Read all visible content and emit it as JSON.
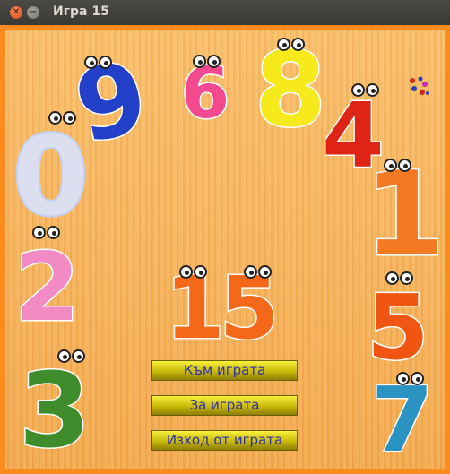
{
  "window": {
    "title": "Игра 15"
  },
  "menu": {
    "start": "Към играта",
    "about": "За играта",
    "exit": "Изход от играта"
  },
  "digits": {
    "nine": "9",
    "six": "6",
    "eight": "8",
    "four": "4",
    "zero": "0",
    "one": "1",
    "two": "2",
    "five": "5",
    "title_fifteen": "15",
    "three": "3",
    "seven": "7"
  },
  "colors": {
    "background": "#f6b25a",
    "frame": "#ff8a1e",
    "button_text": "#2d2fa8"
  }
}
